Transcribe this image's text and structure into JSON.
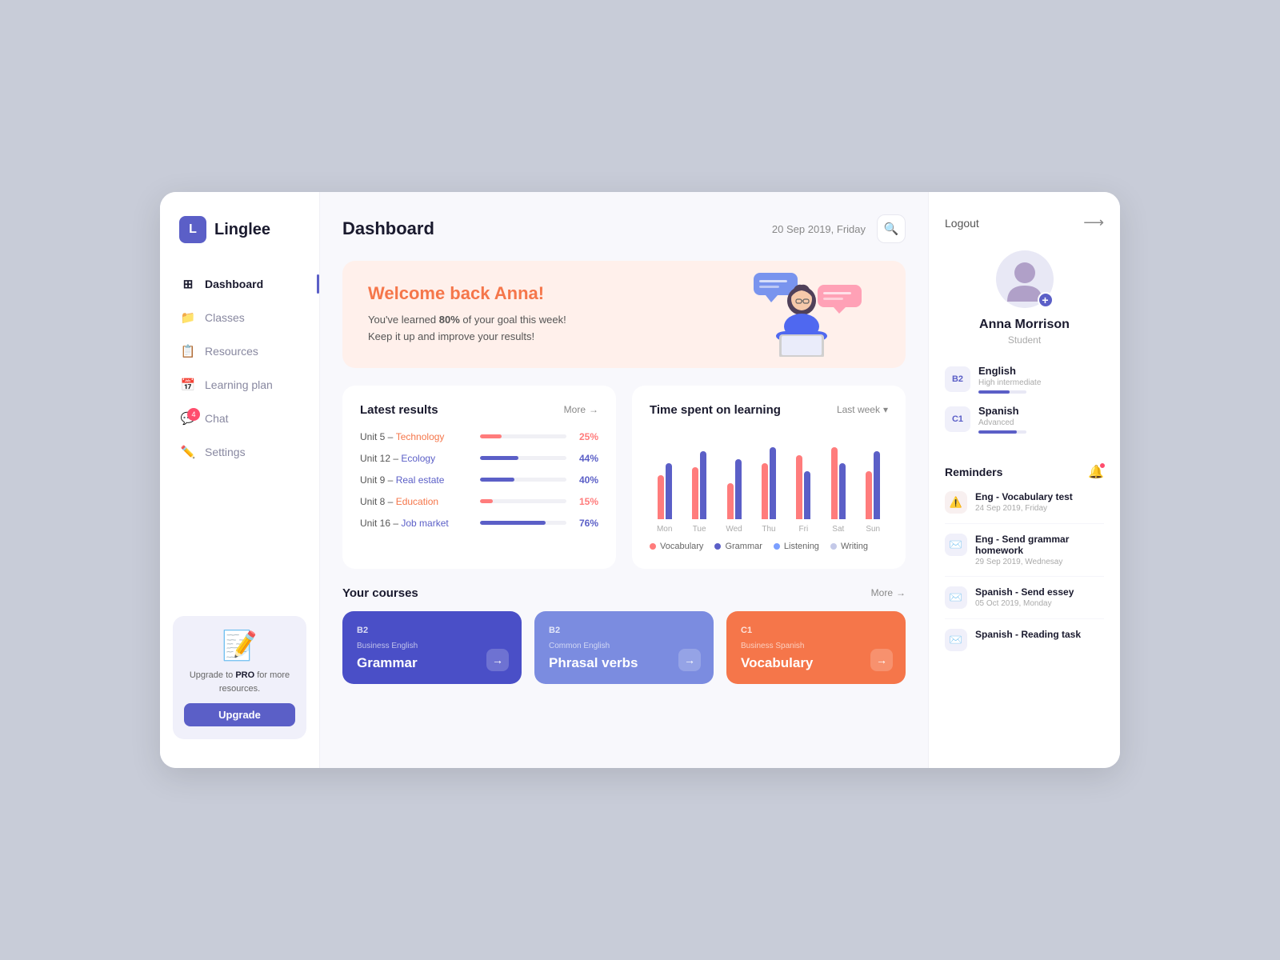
{
  "app": {
    "logo_letter": "L",
    "logo_name": "Linglee"
  },
  "sidebar": {
    "nav_items": [
      {
        "id": "dashboard",
        "label": "Dashboard",
        "icon": "⊞",
        "active": true
      },
      {
        "id": "classes",
        "label": "Classes",
        "icon": "📁",
        "active": false
      },
      {
        "id": "resources",
        "label": "Resources",
        "icon": "📋",
        "active": false
      },
      {
        "id": "learning-plan",
        "label": "Learning plan",
        "icon": "📅",
        "active": false
      },
      {
        "id": "chat",
        "label": "Chat",
        "icon": "💬",
        "active": false,
        "badge": "4"
      },
      {
        "id": "settings",
        "label": "Settings",
        "icon": "✏️",
        "active": false
      }
    ],
    "upgrade_text_before": "Upgrade to ",
    "upgrade_bold": "PRO",
    "upgrade_text_after": " for more resources.",
    "upgrade_btn": "Upgrade"
  },
  "header": {
    "title": "Dashboard",
    "date": "20 Sep 2019, Friday"
  },
  "welcome": {
    "greeting": "Welcome back Anna!",
    "line1": "You've learned ",
    "percent": "80%",
    "line2": " of your goal this week!",
    "line3": "Keep it up and improve your results!"
  },
  "results": {
    "title": "Latest results",
    "more_label": "More",
    "rows": [
      {
        "unit": "Unit 5",
        "topic": "Technology",
        "pct": 25,
        "color": "red"
      },
      {
        "unit": "Unit 12",
        "topic": "Ecology",
        "pct": 44,
        "color": "blue"
      },
      {
        "unit": "Unit 9",
        "topic": "Real estate",
        "pct": 40,
        "color": "blue"
      },
      {
        "unit": "Unit 8",
        "topic": "Education",
        "pct": 15,
        "color": "red"
      },
      {
        "unit": "Unit 16",
        "topic": "Job market",
        "pct": 76,
        "color": "blue"
      }
    ]
  },
  "chart": {
    "title": "Time spent on learning",
    "period": "Last week",
    "days": [
      {
        "label": "Mon",
        "vocab": 55,
        "grammar": 70
      },
      {
        "label": "Tue",
        "vocab": 65,
        "grammar": 85
      },
      {
        "label": "Wed",
        "vocab": 45,
        "grammar": 75
      },
      {
        "label": "Thu",
        "vocab": 70,
        "grammar": 90
      },
      {
        "label": "Fri",
        "vocab": 80,
        "grammar": 60
      },
      {
        "label": "Sat",
        "vocab": 90,
        "grammar": 70
      },
      {
        "label": "Sun",
        "vocab": 60,
        "grammar": 85
      }
    ],
    "legend": [
      "Vocabulary",
      "Grammar",
      "Listening",
      "Writing"
    ]
  },
  "courses": {
    "title": "Your courses",
    "more_label": "More",
    "items": [
      {
        "level": "B2",
        "sub": "Business English",
        "name": "Grammar",
        "color": "blue"
      },
      {
        "level": "B2",
        "sub": "Common English",
        "name": "Phrasal verbs",
        "color": "light"
      },
      {
        "level": "C1",
        "sub": "Business Spanish",
        "name": "Vocabulary",
        "color": "red"
      }
    ]
  },
  "profile": {
    "logout_label": "Logout",
    "name": "Anna Morrison",
    "role": "Student",
    "languages": [
      {
        "badge": "B2",
        "name": "English",
        "level": "High intermediate",
        "pct": 65
      },
      {
        "badge": "C1",
        "name": "Spanish",
        "level": "Advanced",
        "pct": 80
      }
    ]
  },
  "reminders": {
    "title": "Reminders",
    "items": [
      {
        "icon": "⚠️",
        "type": "alert",
        "title": "Eng - Vocabulary test",
        "date": "24 Sep 2019, Friday"
      },
      {
        "icon": "✉️",
        "type": "mail",
        "title": "Eng - Send grammar homework",
        "date": "29 Sep 2019, Wednesay"
      },
      {
        "icon": "✉️",
        "type": "mail",
        "title": "Spanish - Send essey",
        "date": "05 Oct 2019, Monday"
      },
      {
        "icon": "✉️",
        "type": "mail",
        "title": "Spanish - Reading task",
        "date": ""
      }
    ]
  }
}
